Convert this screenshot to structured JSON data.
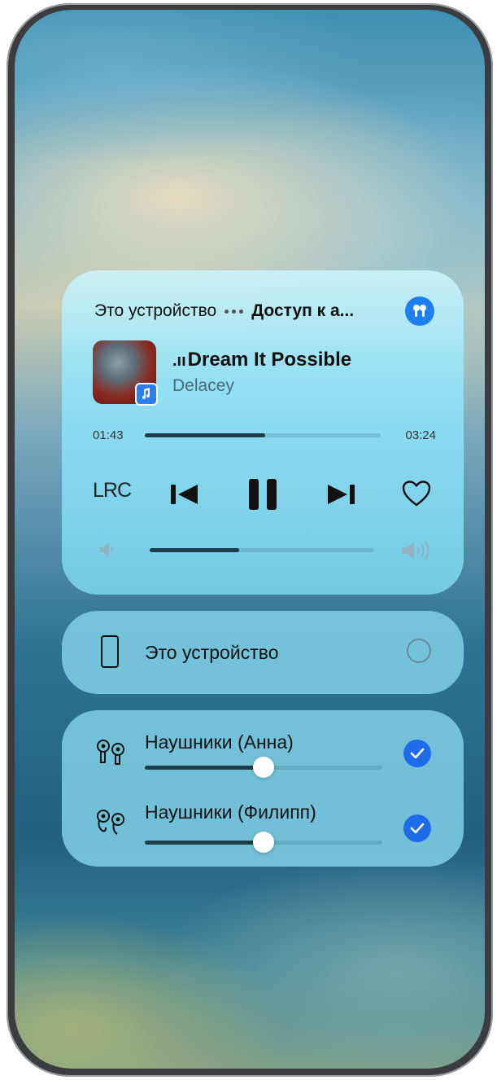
{
  "media": {
    "source_device": "Это устройство",
    "target_device": "Доступ к а...",
    "song_title": "Dream It Possible",
    "artist": "Delacey",
    "elapsed": "01:43",
    "duration": "03:24",
    "progress": 0.51,
    "lrc_label": "LRC",
    "volume": 0.4
  },
  "devices": {
    "this_device_label": "Это устройство",
    "this_device_selected": false
  },
  "headphones": [
    {
      "label": "Наушники (Анна)",
      "volume": 0.5,
      "selected": true
    },
    {
      "label": "Наушники (Филипп)",
      "volume": 0.5,
      "selected": true
    }
  ],
  "colors": {
    "accent": "#1f6cea",
    "progress_fill": "#1c3d4a",
    "card": "#8ce1f5"
  },
  "icons": [
    "airpods-icon",
    "music-app-icon",
    "previous-icon",
    "pause-icon",
    "next-icon",
    "heart-icon",
    "volume-low-icon",
    "volume-high-icon",
    "phone-icon",
    "earbuds-stem-icon",
    "earbuds-round-icon",
    "check-icon"
  ]
}
